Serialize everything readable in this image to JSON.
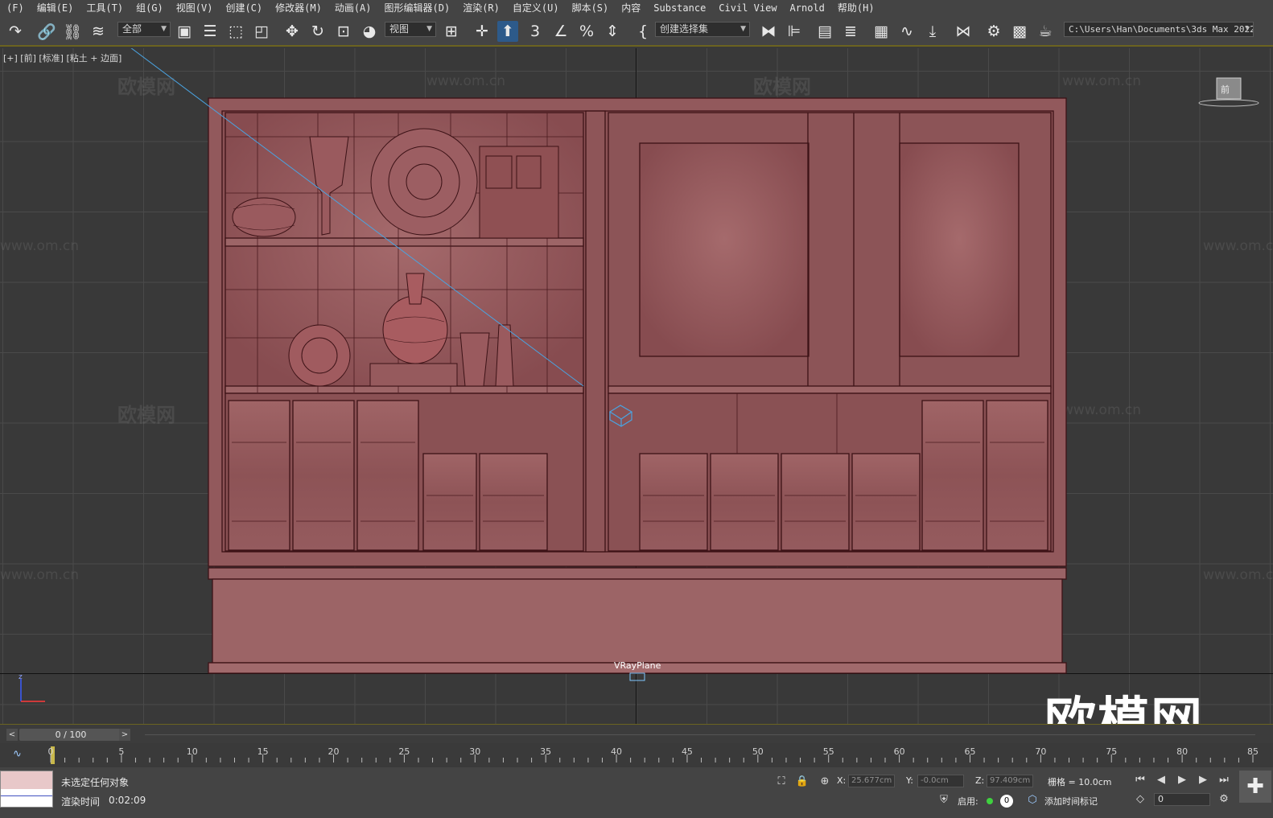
{
  "menu": [
    "(F)",
    "编辑(E)",
    "工具(T)",
    "组(G)",
    "视图(V)",
    "创建(C)",
    "修改器(M)",
    "动画(A)",
    "图形编辑器(D)",
    "渲染(R)",
    "自定义(U)",
    "脚本(S)",
    "内容",
    "Substance",
    "Civil View",
    "Arnold",
    "帮助(H)"
  ],
  "toolbar": {
    "selection_filter": "全部",
    "reference_coord": "视图",
    "named_selection": "创建选择集",
    "project_path": "C:\\Users\\Han\\Documents\\3ds Max 2022",
    "snap_toggle": "3",
    "icons": [
      "redo-icon",
      "link-icon",
      "unlink-icon",
      "bind-spacewarp-icon",
      "select-object-icon",
      "select-by-name-icon",
      "rectangular-selection-icon",
      "window-crossing-icon",
      "move-icon",
      "rotate-icon",
      "scale-icon",
      "placement-icon",
      "pivot-icon",
      "snaps-toggle-icon",
      "angle-snap-icon",
      "percent-snap-icon",
      "spinner-snap-icon",
      "edit-named-selection-icon",
      "mirror-icon",
      "align-icon",
      "scene-explorer-icon",
      "layer-explorer-icon",
      "toggle-ribbon-icon",
      "curve-editor-icon",
      "dope-sheet-icon",
      "schematic-view-icon",
      "render-setup-icon",
      "render-frame-icon",
      "render-production-icon"
    ]
  },
  "viewport": {
    "label": "[+] [前] [标准] [粘土 + 边面]",
    "object_label": "VRayPlane",
    "watermark_text": "欧模网",
    "watermark_url": "www.om.cn",
    "watermark_big": "欧模网",
    "viewcube_label": "前",
    "model_color": "#8e5558",
    "axis_label": "z"
  },
  "timeslider": {
    "frame_display": "0 / 100",
    "prev": "<",
    "next": ">"
  },
  "trackbar": {
    "ticks": [
      "0",
      "5",
      "10",
      "15",
      "20",
      "25",
      "30",
      "35",
      "40",
      "45",
      "50",
      "55",
      "60",
      "65",
      "70",
      "75",
      "80",
      "85"
    ]
  },
  "status": {
    "selection": "未选定任何对象",
    "render_time_label": "渲染时间",
    "render_time_value": "0:02:09",
    "x_label": "X:",
    "x_value": "25.677cm",
    "y_label": "Y:",
    "y_value": "-0.0cm",
    "z_label": "Z:",
    "z_value": "97.409cm",
    "grid": "栅格 = 10.0cm",
    "enable_label": "启用:",
    "enable_count": "0",
    "add_time_tag": "添加时间标记",
    "current_frame": "0"
  }
}
